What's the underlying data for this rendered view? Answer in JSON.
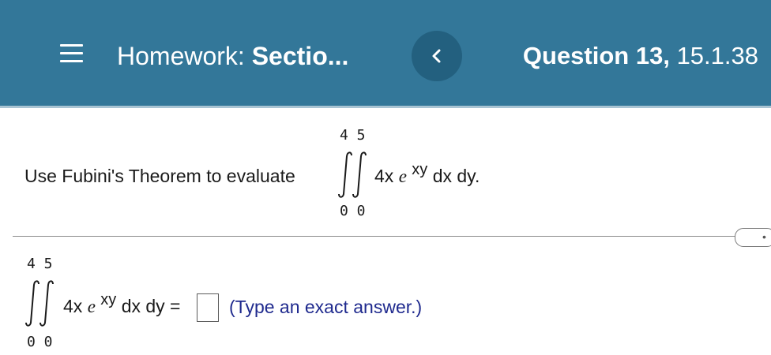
{
  "header": {
    "menu_icon": "hamburger-menu-icon",
    "homework_prefix": "Homework:",
    "homework_title": "Sectio...",
    "back_icon": "chevron-left-icon",
    "question_prefix": "Question 13,",
    "question_id": "15.1.38"
  },
  "problem": {
    "prompt": "Use Fubini's Theorem to evaluate",
    "upper_limits": "4 5",
    "lower_limits": "0 0",
    "integrand_coef": "4x",
    "integrand_base": "e",
    "integrand_exponent": "xy",
    "differentials": "dx dy."
  },
  "answer": {
    "upper_limits": "4 5",
    "lower_limits": "0 0",
    "integrand_coef": "4x",
    "integrand_base": "e",
    "integrand_exponent": "xy",
    "differentials_equals": "dx dy =",
    "input_value": "",
    "hint": "(Type an exact answer.)"
  },
  "colors": {
    "header_bg": "#337799",
    "back_button_bg": "#23607f",
    "hint_text": "#1f2a8e"
  }
}
